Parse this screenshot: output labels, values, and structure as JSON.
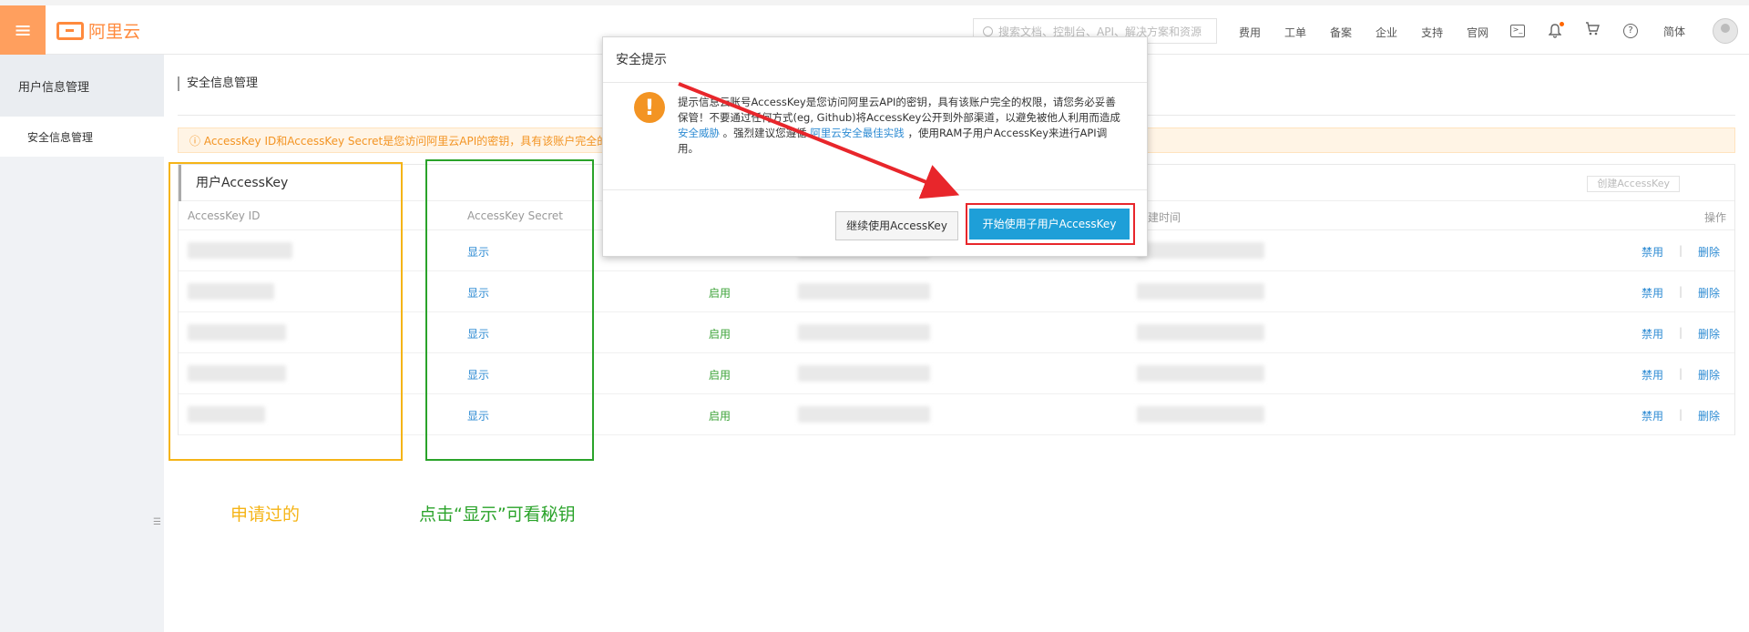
{
  "topbar": {
    "brand": "阿里云",
    "search_placeholder": "搜索文档、控制台、API、解决方案和资源",
    "nav": [
      "费用",
      "工单",
      "备案",
      "企业",
      "支持",
      "官网"
    ],
    "lang": "简体",
    "icons": [
      "terminal-icon",
      "bell-icon",
      "cart-icon",
      "help-icon",
      "avatar-icon"
    ]
  },
  "sidebar": {
    "section_title": "用户信息管理",
    "items": [
      {
        "label": "安全信息管理"
      }
    ]
  },
  "main": {
    "page_title": "安全信息管理",
    "warning": "ⓘ AccessKey ID和AccessKey Secret是您访问阿里云API的密钥，具有该账户完全的权",
    "table": {
      "title": "用户AccessKey",
      "create_button": "创建AccessKey",
      "columns": {
        "id": "AccessKey ID",
        "secret": "AccessKey Secret",
        "created": "创建时间",
        "actions": "操作"
      },
      "rows": [
        {
          "secret_action": "显示",
          "status": "",
          "disable": "禁用",
          "delete": "删除"
        },
        {
          "secret_action": "显示",
          "status": "启用",
          "disable": "禁用",
          "delete": "删除"
        },
        {
          "secret_action": "显示",
          "status": "启用",
          "disable": "禁用",
          "delete": "删除"
        },
        {
          "secret_action": "显示",
          "status": "启用",
          "disable": "禁用",
          "delete": "删除"
        },
        {
          "secret_action": "显示",
          "status": "启用",
          "disable": "禁用",
          "delete": "删除"
        }
      ]
    }
  },
  "annotations": {
    "yellow_label": "申请过的",
    "green_label": "点击“显示”可看秘钥"
  },
  "modal": {
    "title": "安全提示",
    "text_part1": "提示信息云账号AccessKey是您访问阿里云API的密钥，具有该账户完全的权限，请您务必妥善保管！不要通过任何方式(eg, Github)将AccessKey公开到外部渠道，以避免被他人利用而造成",
    "link1": "安全威胁",
    "text_part2": "。强烈建议您遵循",
    "link2": "阿里云安全最佳实践",
    "text_part3": "，使用RAM子用户AccessKey来进行API调用。",
    "continue_button": "继续使用AccessKey",
    "start_button": "开始使用子用户AccessKey"
  },
  "colors": {
    "brand_orange": "#ff8a3d",
    "annotation_yellow": "#f5b417",
    "annotation_green": "#2aa32a",
    "annotation_red": "#e8262b",
    "primary_blue": "#1e9fd8"
  }
}
